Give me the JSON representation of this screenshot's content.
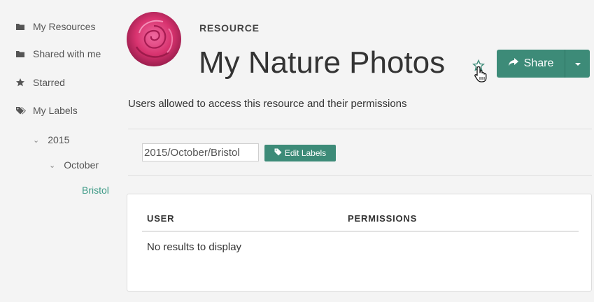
{
  "sidebar": {
    "items": [
      {
        "label": "My Resources",
        "icon": "folder-icon"
      },
      {
        "label": "Shared with me",
        "icon": "folder-icon"
      },
      {
        "label": "Starred",
        "icon": "star-icon"
      },
      {
        "label": "My Labels",
        "icon": "tags-icon"
      }
    ],
    "tree": [
      {
        "label": "2015",
        "level": 1,
        "expanded": true
      },
      {
        "label": "October",
        "level": 2,
        "expanded": true
      },
      {
        "label": "Bristol",
        "level": 3,
        "active": true
      }
    ]
  },
  "resource": {
    "eyebrow": "RESOURCE",
    "title": "My Nature Photos",
    "description": "Users allowed to access this resource and their permissions"
  },
  "actions": {
    "share_label": "Share",
    "edit_labels_label": "Edit Labels"
  },
  "labels": {
    "value": "2015/October/Bristol"
  },
  "table": {
    "columns": [
      "USER",
      "PERMISSIONS"
    ],
    "empty_message": "No results to display"
  },
  "colors": {
    "accent": "#3d8b78",
    "active_link": "#3d9a86",
    "background": "#f4f4f4"
  }
}
